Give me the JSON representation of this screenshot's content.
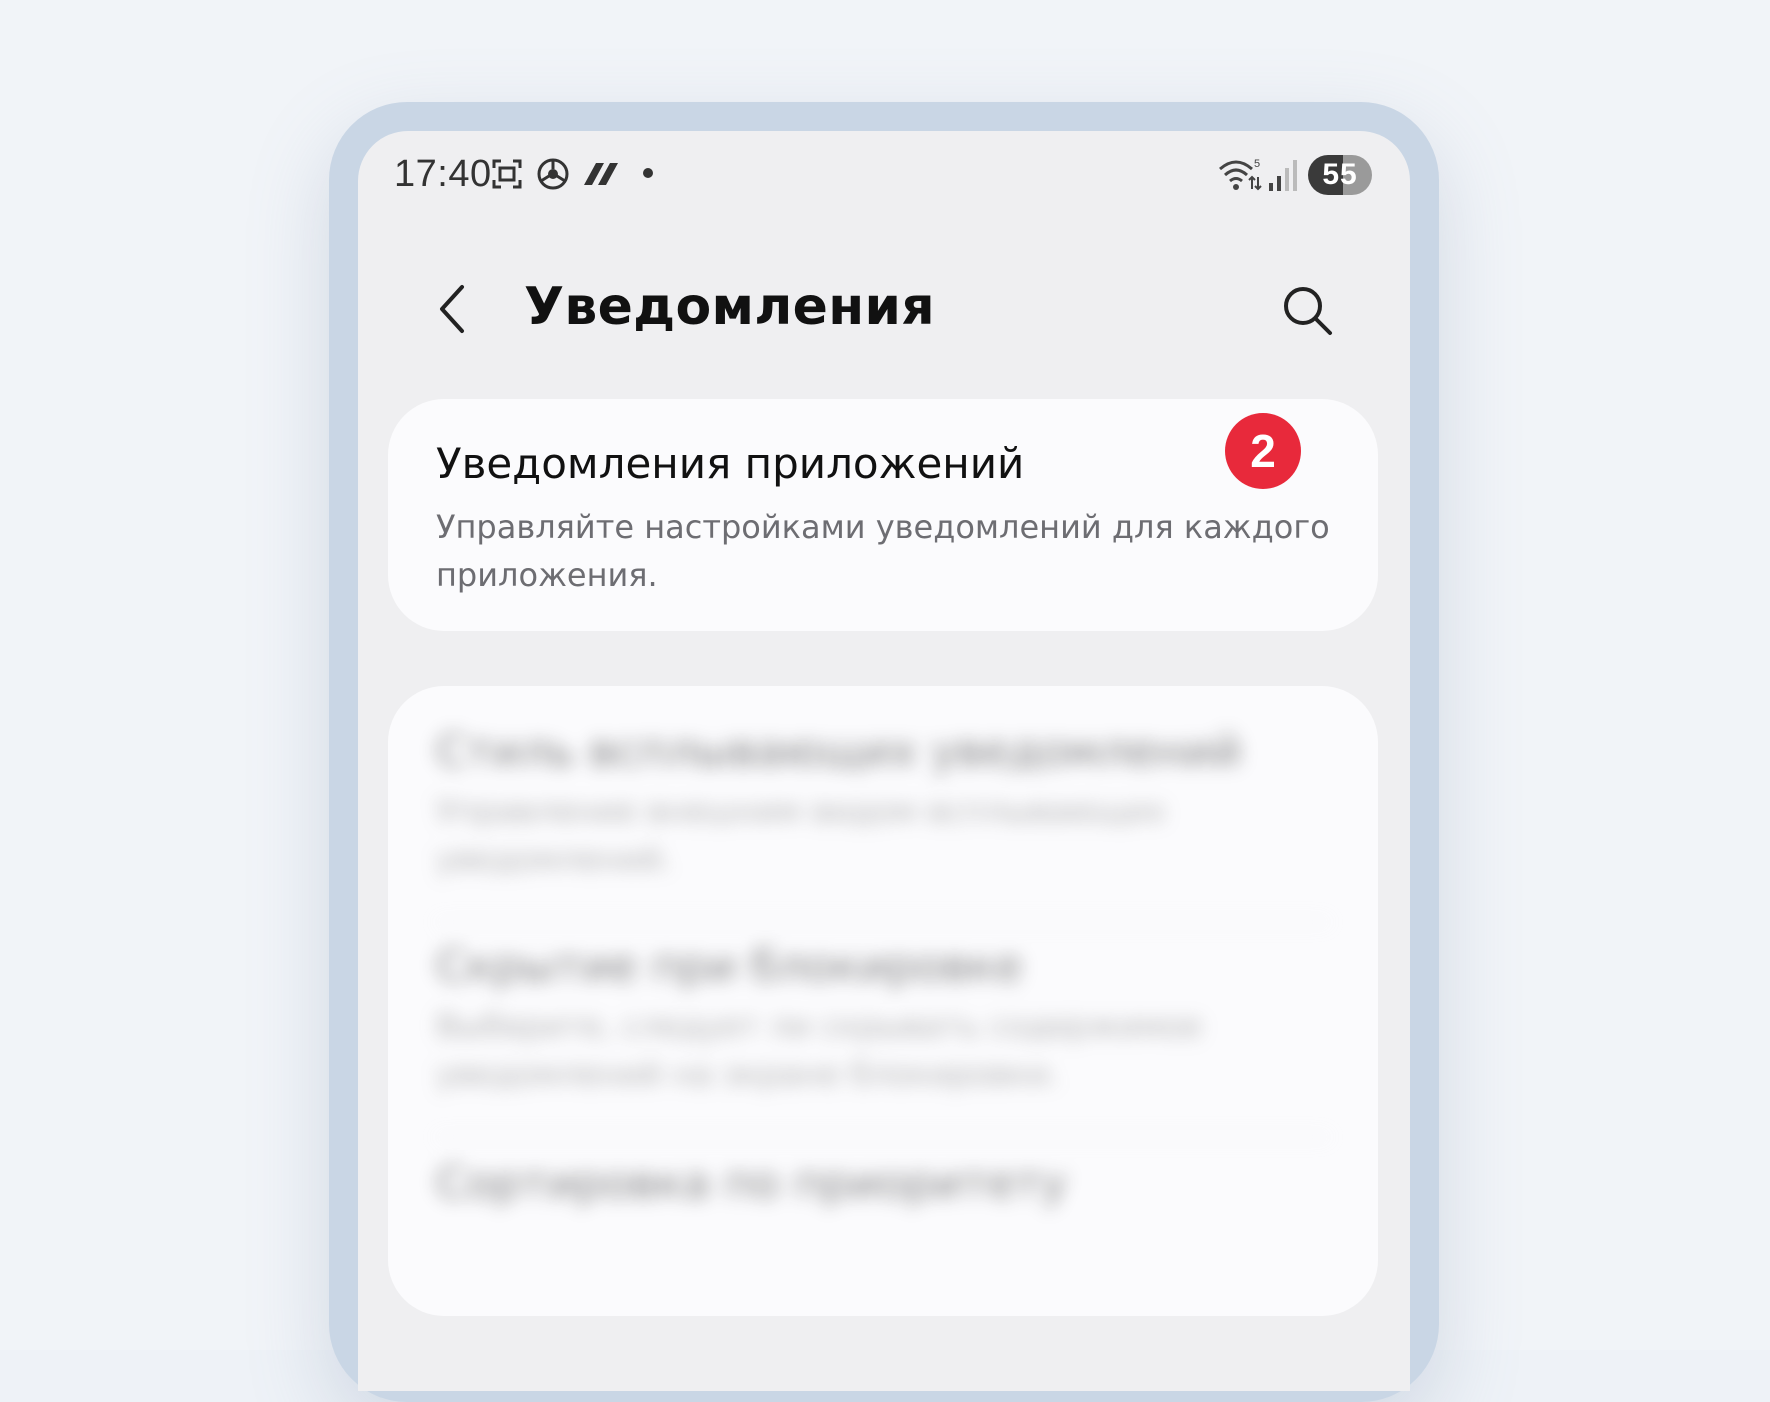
{
  "status_bar": {
    "time": "17:40",
    "icons": [
      "screenshot-icon",
      "chrome-icon",
      "slash-app-icon",
      "notification-dot-icon"
    ],
    "wifi_label": "5",
    "battery": "55",
    "battery_level": 0.55
  },
  "header": {
    "back_icon": "chevron-left-icon",
    "title": "Уведомления",
    "search_icon": "search-icon"
  },
  "app_notifications": {
    "title": "Уведомления приложений",
    "subtitle": "Управляйте настройками уведомлений для каждого приложения.",
    "badge": "2",
    "badge_color": "#e8293b"
  },
  "blurred_settings": {
    "items": [
      {
        "title": "Стиль всплывающих уведомлений",
        "subtitle": "Управление внешним видом всплывающих уведомлений."
      },
      {
        "title": "Скрытие при блокировке",
        "subtitle": "Выберите, следует ли скрывать содержимое уведомлений на экране блокировки."
      },
      {
        "title": "Сортировка по приоритету"
      }
    ]
  }
}
